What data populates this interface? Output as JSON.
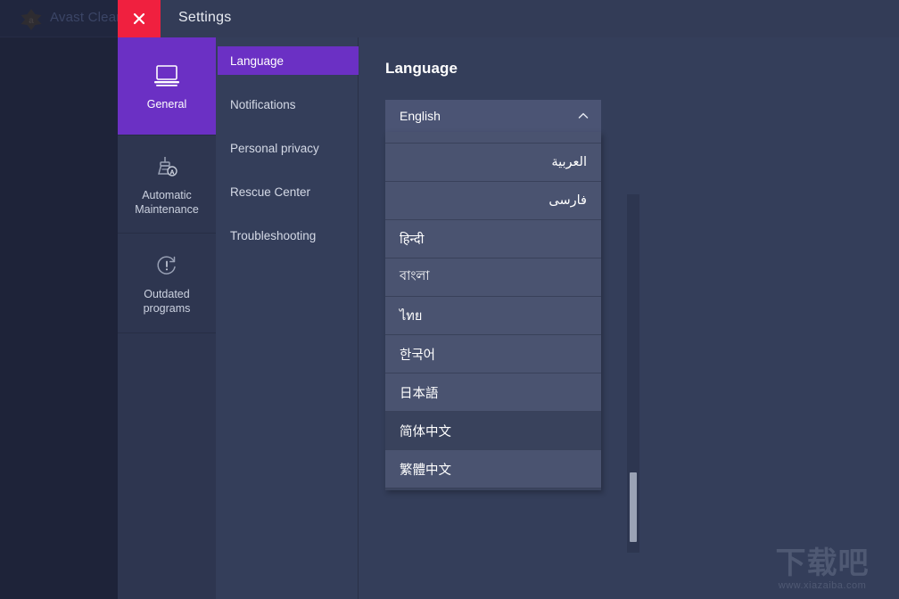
{
  "background_window": {
    "app_title": "Avast Clean",
    "logo_icon": "avast-logo-icon"
  },
  "settings_window": {
    "title": "Settings",
    "close_icon": "close-icon"
  },
  "rail": {
    "items": [
      {
        "label": "General",
        "icon": "laptop-icon",
        "active": true
      },
      {
        "label": "Automatic\nMaintenance",
        "label_line1": "Automatic",
        "label_line2": "Maintenance",
        "icon": "auto-maintenance-brush-icon",
        "active": false
      },
      {
        "label": "Outdated\nprograms",
        "label_line1": "Outdated",
        "label_line2": "programs",
        "icon": "outdated-programs-warning-icon",
        "active": false
      }
    ]
  },
  "nav": {
    "items": [
      {
        "label": "Language",
        "active": true
      },
      {
        "label": "Notifications",
        "active": false
      },
      {
        "label": "Personal privacy",
        "active": false
      },
      {
        "label": "Rescue Center",
        "active": false
      },
      {
        "label": "Troubleshooting",
        "active": false
      }
    ]
  },
  "main": {
    "title": "Language",
    "select": {
      "selected_value": "English",
      "expanded": true,
      "chevron_icon": "chevron-up-icon",
      "options": [
        {
          "label": "",
          "partial": true,
          "highlighted": false
        },
        {
          "label": "العربية",
          "rtl": true,
          "highlighted": false
        },
        {
          "label": "فارسی",
          "rtl": true,
          "highlighted": false
        },
        {
          "label": "हिन्दी",
          "rtl": false,
          "highlighted": false
        },
        {
          "label": "বাংলা",
          "rtl": false,
          "highlighted": false
        },
        {
          "label": "ไทย",
          "rtl": false,
          "highlighted": false
        },
        {
          "label": "한국어",
          "rtl": false,
          "highlighted": false
        },
        {
          "label": "日本語",
          "rtl": false,
          "highlighted": false
        },
        {
          "label": "简体中文",
          "rtl": false,
          "highlighted": true
        },
        {
          "label": "繁體中文",
          "rtl": false,
          "highlighted": false
        }
      ]
    },
    "scrollbar": {
      "name": "dropdown-scrollbar"
    }
  },
  "watermark": {
    "text_cn": "下载吧",
    "url": "www.xiazaiba.com"
  },
  "colors": {
    "accent_purple": "#6b30c4",
    "close_red": "#f0203f",
    "panel_bg": "#343e5a",
    "rail_bg": "#2e3650",
    "backdrop": "#1e2339",
    "select_btn": "#4b5474",
    "option_bg": "#4a5370",
    "option_highlight": "#39425c"
  }
}
